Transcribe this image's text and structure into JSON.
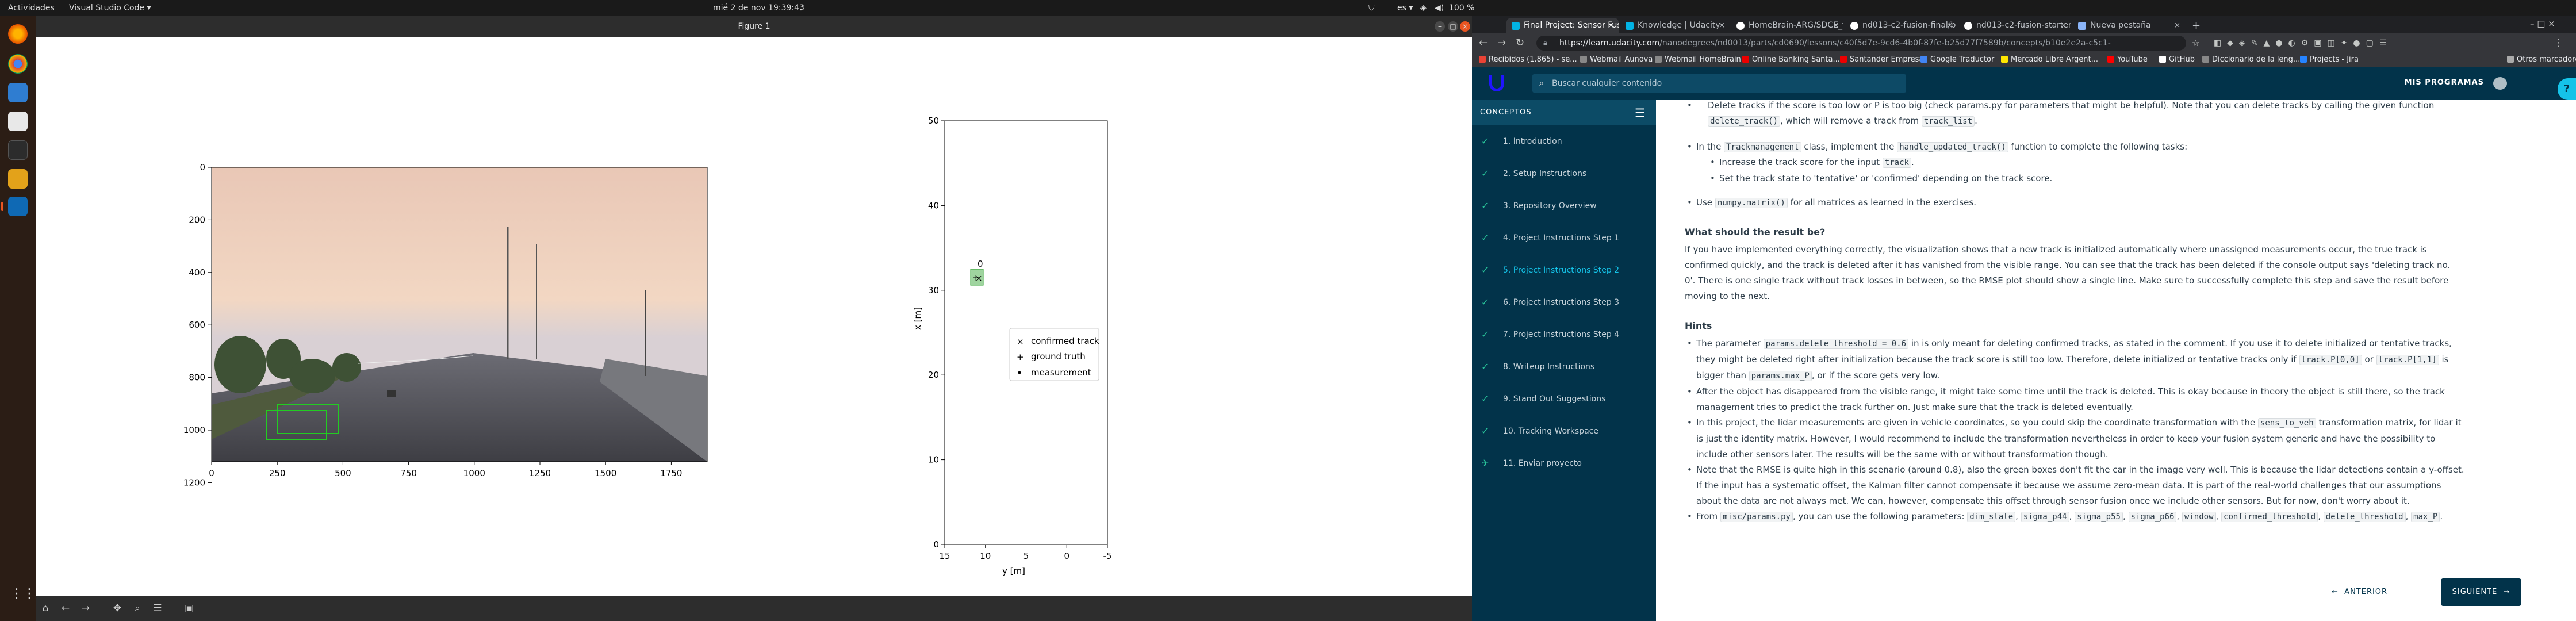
{
  "topbar": {
    "activities": "Actividades",
    "app": "Visual Studio Code ▾",
    "clock": "mié 2 de nov  19:39:43",
    "battery": "100 %",
    "lang": "es ▾"
  },
  "figure": {
    "title": "Figure 1",
    "left_plot": {
      "xticks": [
        "0",
        "250",
        "500",
        "750",
        "1000",
        "1250",
        "1500",
        "1750"
      ],
      "yticks": [
        "0",
        "200",
        "400",
        "600",
        "800",
        "1000",
        "1200"
      ]
    },
    "right_plot": {
      "xlabel": "y [m]",
      "ylabel": "x [m]",
      "xticks": [
        "15",
        "10",
        "5",
        "0",
        "-5"
      ],
      "yticks": [
        "50",
        "40",
        "30",
        "20",
        "10",
        "0"
      ],
      "track_id": "0",
      "legend": [
        "confirmed track",
        "ground truth",
        "measurement"
      ]
    }
  },
  "browser": {
    "tabs": [
      {
        "label": "Final Project: Sensor Fus",
        "color": "#02b3e4"
      },
      {
        "label": "Knowledge | Udacity",
        "color": "#02b3e4"
      },
      {
        "label": "HomeBrain-ARG/SDCE_f",
        "color": "#ffffff"
      },
      {
        "label": "nd013-c2-fusion-final/b",
        "color": "#ffffff"
      },
      {
        "label": "nd013-c2-fusion-starter-",
        "color": "#ffffff"
      },
      {
        "label": "Nueva pestaña",
        "color": "#8ab4f8"
      }
    ],
    "url_host": "https://learn.udacity.com",
    "url_path": "/nanodegrees/nd0013/parts/cd0690/lessons/c40f5d7e-9cd6-4b0f-87fe-b25d77f7589b/concepts/b10e2e2a-c5c1-",
    "bookmarks": [
      "Recibidos (1.865) - se...",
      "Webmail Aunova",
      "Webmail HomeBrain",
      "Online Banking Santa...",
      "Santander Empresas",
      "Google Traductor",
      "Mercado Libre Argent...",
      "YouTube",
      "GitHub",
      "Diccionario de la leng...",
      "Projects - Jira"
    ],
    "bookmarks_other": "Otros marcadores"
  },
  "udacity": {
    "search_placeholder": "Buscar cualquier contenido",
    "mis_programas": "MIS PROGRAMAS",
    "conceptos": "CONCEPTOS",
    "sidebar": [
      "1. Introduction",
      "2. Setup Instructions",
      "3. Repository Overview",
      "4. Project Instructions Step 1",
      "5. Project Instructions Step 2",
      "6. Project Instructions Step 3",
      "7. Project Instructions Step 4",
      "8. Writeup Instructions",
      "9. Stand Out Suggestions",
      "10. Tracking Workspace",
      "11. Enviar proyecto"
    ],
    "content": {
      "b1a": "Delete tracks if the score is too low or P is too big (check params.py for parameters that might be helpful). Note that you can delete tracks by calling the given function",
      "b1b": "delete_track()",
      "b1c": ", which will remove a track from",
      "b1d": "track_list",
      ".": ".",
      "b2a": "In the",
      "b2b": "Trackmanagement",
      "b2c": "class, implement the",
      "b2d": "handle_updated_track()",
      "b2e": "function to complete the following tasks:",
      "s1a": "Increase the track score for the input",
      "s1b": "track",
      "s2": "Set the track state to 'tentative' or 'confirmed' depending on the track score.",
      "b3a": "Use",
      "b3b": "numpy.matrix()",
      "b3c": "for all matrices as learned in the exercises.",
      "h1": "What should the result be?",
      "p1": "If you have implemented everything correctly, the visualization shows that a new track is initialized automatically where unassigned measurements occur, the true track is confirmed quickly, and the track is deleted after it has vanished from the visible range. You can see that the track has been deleted if the console output says 'deleting track no. 0'. There is one single track without track losses in between, so the RMSE plot should show a single line. Make sure to successfully complete this step and save the result before moving to the next.",
      "h2": "Hints",
      "h_a1": "The parameter",
      "h_a2": "params.delete_threshold = 0.6",
      "h_a3": "in is only meant for deleting confirmed tracks, as stated in the comment. If you use it to delete initialized or tentative tracks, they might be deleted right after initialization because the track score is still too low. Therefore, delete initialized or tentative tracks only if",
      "h_a4": "track.P[0,0]",
      "h_a5": "or",
      "h_a6": "track.P[1,1]",
      "h_a7": "is bigger than",
      "h_a8": "params.max_P",
      "h_a9": ", or if the score gets very low.",
      "h_b": "After the object has disappeared from the visible range, it might take some time until the track is deleted. This is okay because in theory the object is still there, so the track management tries to predict the track further on. Just make sure that the track is deleted eventually.",
      "h_c1": "In this project, the lidar measurements are given in vehicle coordinates, so you could skip the coordinate transformation with the",
      "h_c2": "sens_to_veh",
      "h_c3": "transformation matrix, for lidar it is just the identity matrix. However, I would recommend to include the transformation nevertheless in order to keep your fusion system generic and have the possibility to include other sensors later. The results will be the same with or without transformation though.",
      "h_d": "Note that the RMSE is quite high in this scenario (around 0.8), also the green boxes don't fit the car in the image very well. This is because the lidar detections contain a y-offset. If the input has a systematic offset, the Kalman filter cannot compensate it because we assume zero-mean data. It is part of the real-world challenges that our assumptions about the data are not always met. We can, however, compensate this offset through sensor fusion once we include other sensors. But for now, don't worry about it.",
      "h_e1": "From",
      "h_e2": "misc/params.py",
      "h_e3": ", you can use the following parameters:",
      "params": [
        "dim_state",
        "sigma_p44",
        "sigma_p55",
        "sigma_p66",
        "window",
        "confirmed_threshold",
        "delete_threshold",
        "max_P"
      ],
      "dot": "."
    },
    "btn_prev": "ANTERIOR",
    "btn_next": "SIGUIENTE"
  },
  "colors": {
    "udacity_navy": "#02334a",
    "accent": "#15c3e8",
    "check": "#29c69b",
    "ubuntu_orange": "#e95420",
    "track_green": "#2ca02c"
  }
}
